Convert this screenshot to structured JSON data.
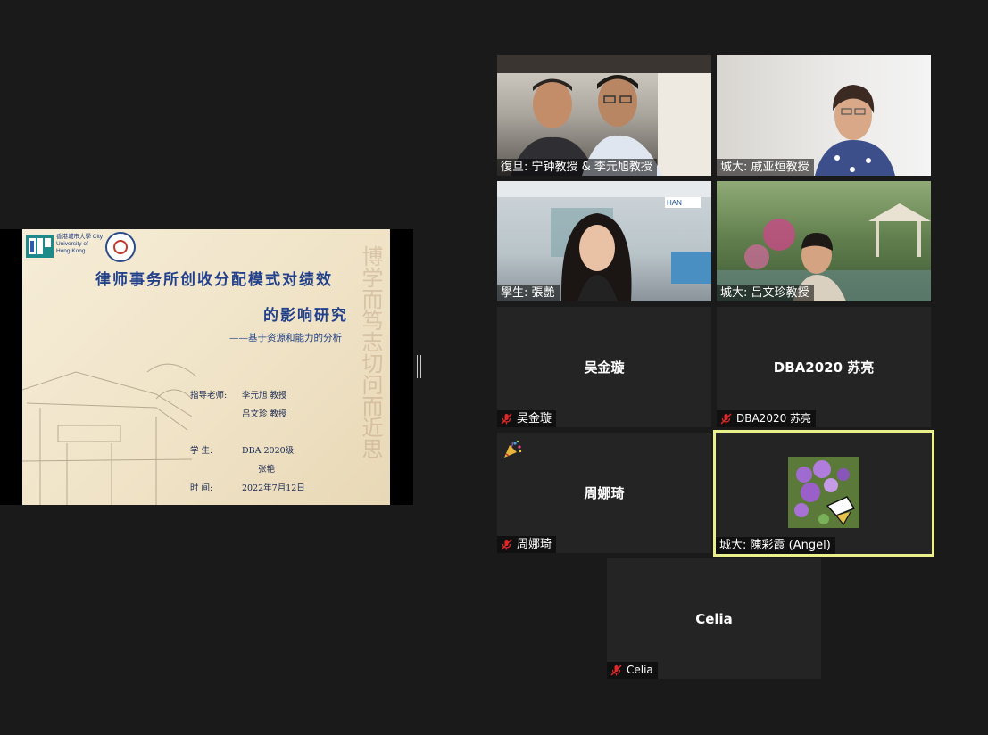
{
  "slide": {
    "logo_text": "香港城市大學 City University of Hong Kong",
    "title_line1": "律师事务所创收分配模式对绩效",
    "title_line2": "的影响研究",
    "subtitle": "——基于资源和能力的分析",
    "advisor_label": "指导老师:",
    "advisor_1": "李元旭  教授",
    "advisor_2": "吕文珍  教授",
    "student_label": "学    生:",
    "student_1": "DBA 2020级",
    "student_2": "张艳",
    "time_label": "时    间:",
    "time_value": "2022年7月12日",
    "calligraphy": "博学而笃志切问而近思"
  },
  "participants": [
    {
      "name": "復旦: 宁钟教授 & 李元旭教授",
      "video": true,
      "muted": false
    },
    {
      "name": "城大: 戚亚烜教授",
      "video": true,
      "muted": false
    },
    {
      "name": "學生: 張艷",
      "video": true,
      "muted": false
    },
    {
      "name": "城大: 吕文珍教授",
      "video": true,
      "muted": false
    },
    {
      "name": "吴金璇",
      "center_label": "吴金璇",
      "video": false,
      "muted": true
    },
    {
      "name": "DBA2020 苏亮",
      "center_label": "DBA2020 苏亮",
      "video": false,
      "muted": true
    },
    {
      "name": "周娜琦",
      "center_label": "周娜琦",
      "video": false,
      "muted": true,
      "reaction": "party-popper"
    },
    {
      "name": "城大: 陳彩霞 (Angel)",
      "video": false,
      "muted": false,
      "avatar": "flower-butterfly",
      "active_speaker": true
    },
    {
      "name": "Celia",
      "center_label": "Celia",
      "video": false,
      "muted": true
    }
  ],
  "colors": {
    "background": "#1a1a1a",
    "tile": "#242424",
    "active_border": "#e9f08c",
    "muted_icon": "#e02828"
  }
}
